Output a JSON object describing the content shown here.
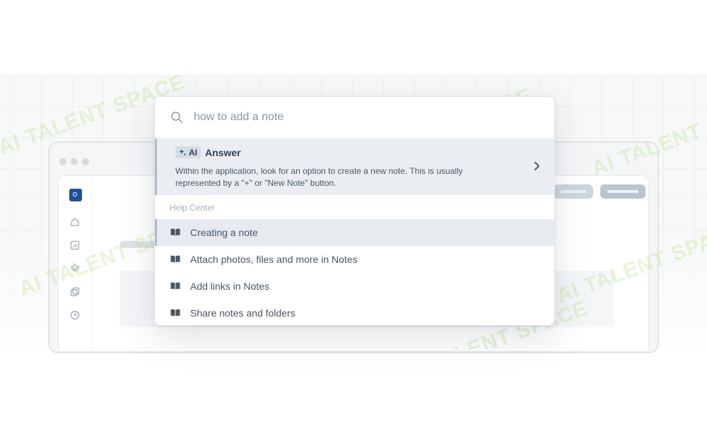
{
  "search": {
    "query": "how to add a note",
    "icon": "search-icon"
  },
  "answer": {
    "badge": "AI",
    "badge_icon": "sparkle-icon",
    "title": "Answer",
    "text": "Within the application, look for an option to create a new note. This is usually represented by a \"+\" or \"New Note\" button."
  },
  "help_center": {
    "label": "Help Center",
    "items": [
      {
        "label": "Creating a note",
        "icon": "book-icon",
        "selected": true
      },
      {
        "label": "Attach photos, files and more in Notes",
        "icon": "book-icon",
        "selected": false
      },
      {
        "label": "Add links in Notes",
        "icon": "book-icon",
        "selected": false
      },
      {
        "label": "Share notes and folders",
        "icon": "book-icon",
        "selected": false
      }
    ]
  },
  "watermark": "AI TALENT SPACE",
  "colors": {
    "accent_bar": "#aebacb",
    "selected_bg": "#e7ebf0",
    "answer_bg": "#eaeef3",
    "app_logo": "#1f4f9c"
  }
}
